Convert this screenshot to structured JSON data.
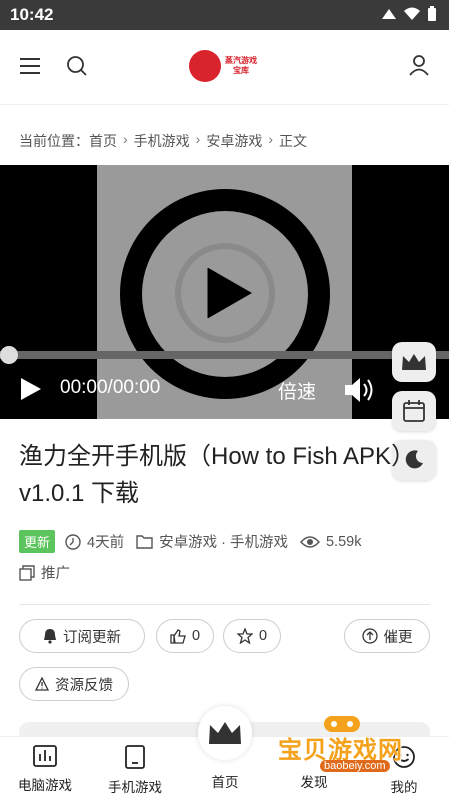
{
  "status": {
    "time": "10:42"
  },
  "header": {
    "logo_line1": "蒸汽游戏",
    "logo_line2": "宝库"
  },
  "breadcrumb": {
    "prefix": "当前位置：",
    "items": [
      "首页",
      "手机游戏",
      "安卓游戏",
      "正文"
    ]
  },
  "video": {
    "time": "00:00/00:00",
    "speed": "倍速",
    "progress": 0
  },
  "article": {
    "title": "渔力全开手机版（How to Fish APK）v1.0.1 下载",
    "badge": "更新",
    "date": "4天前",
    "categories": "安卓游戏 · 手机游戏",
    "views": "5.59k",
    "promo": "推广"
  },
  "actions": {
    "subscribe": "订阅更新",
    "likes": "0",
    "favorites": "0",
    "urge": "催更",
    "feedback": "资源反馈"
  },
  "nav": {
    "pc": "电脑游戏",
    "mobile": "手机游戏",
    "home": "首页",
    "discover": "发现",
    "me": "我的"
  },
  "watermark": {
    "title": "宝贝游戏网",
    "url": "baobeiy.com"
  },
  "colors": {
    "brand": "#d9232d",
    "badge": "#5cc45c",
    "watermark": "#f4a21c"
  }
}
